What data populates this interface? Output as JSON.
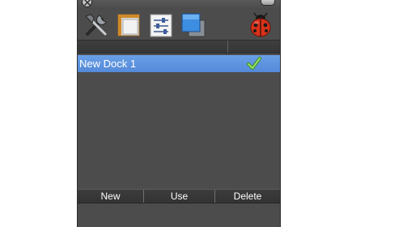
{
  "list": {
    "rows": [
      {
        "label": "New Dock 1",
        "active": true
      }
    ],
    "selected_color": "#5b92dd"
  },
  "toolbar": {
    "icons": [
      "tools-icon",
      "frame-icon",
      "sliders-icon",
      "windows-icon",
      "ladybug-icon"
    ]
  },
  "buttons": {
    "new": "New",
    "use": "Use",
    "delete": "Delete"
  }
}
